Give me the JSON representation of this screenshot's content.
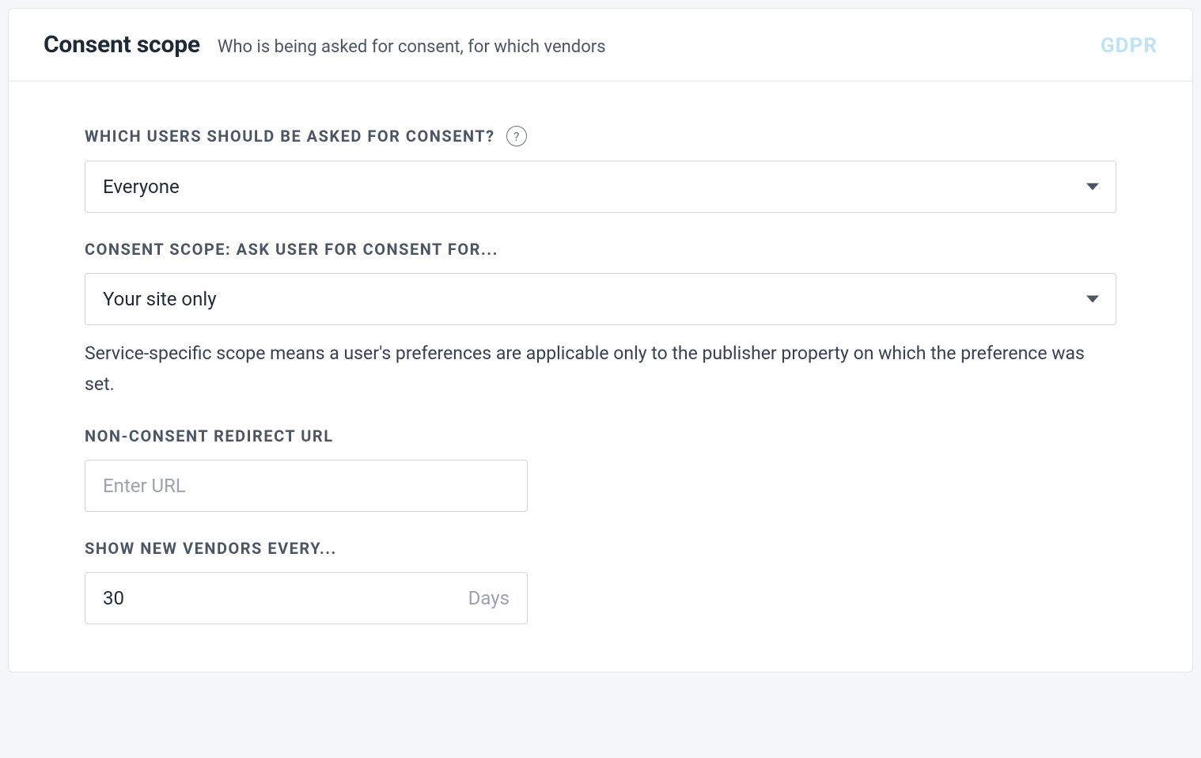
{
  "header": {
    "title": "Consent scope",
    "subtitle": "Who is being asked for consent, for which vendors",
    "badge": "GDPR"
  },
  "form": {
    "users": {
      "label": "WHICH USERS SHOULD BE ASKED FOR CONSENT?",
      "value": "Everyone",
      "help": "?"
    },
    "scope": {
      "label": "CONSENT SCOPE: ASK USER FOR CONSENT FOR...",
      "value": "Your site only",
      "helper": "Service-specific scope means a user's preferences are applicable only to the publisher property on which the preference was set."
    },
    "redirect": {
      "label": "NON-CONSENT REDIRECT URL",
      "placeholder": "Enter URL",
      "value": ""
    },
    "vendors": {
      "label": "SHOW NEW VENDORS EVERY...",
      "value": "30",
      "unit": "Days"
    }
  }
}
